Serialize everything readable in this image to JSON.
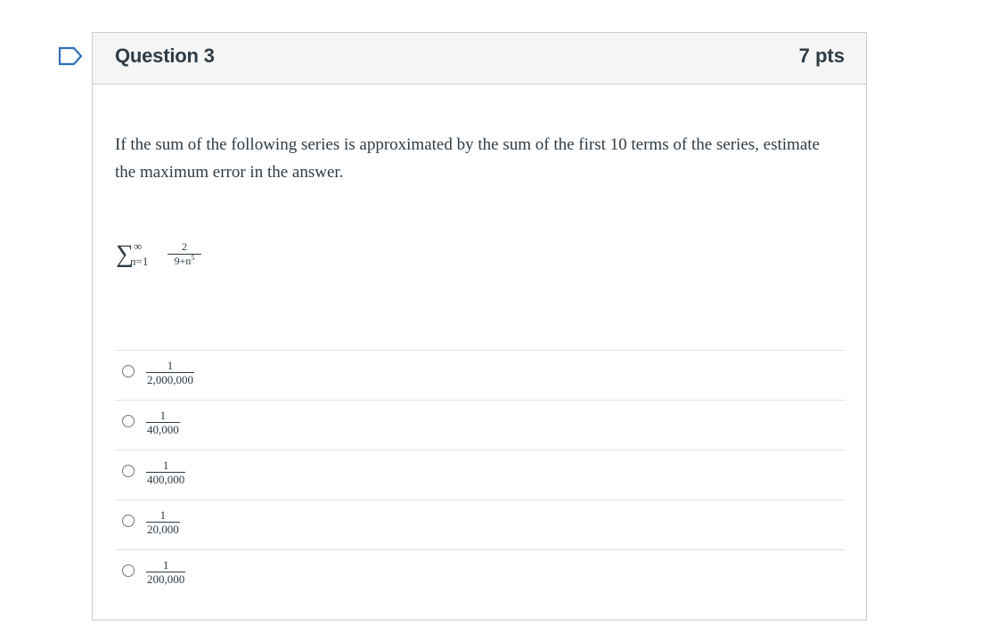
{
  "question": {
    "title": "Question 3",
    "points": "7 pts",
    "text": "If the sum of the following series is approximated by the sum of the first 10 terms of the series, estimate the maximum error in the answer.",
    "formula": {
      "sigma": "∑",
      "upper": "∞",
      "lower_var": "n",
      "lower_eq": "=1",
      "numerator": "2",
      "denominator": "9+n",
      "exponent": "5"
    }
  },
  "answers": [
    {
      "numerator": "1",
      "denominator": "2,000,000"
    },
    {
      "numerator": "1",
      "denominator": "40,000"
    },
    {
      "numerator": "1",
      "denominator": "400,000"
    },
    {
      "numerator": "1",
      "denominator": "20,000"
    },
    {
      "numerator": "1",
      "denominator": "200,000"
    }
  ],
  "colors": {
    "text": "#2d3b45",
    "header_bg": "#f5f5f5",
    "border": "#c7cdd1",
    "flag_outline": "#2d6fb7"
  },
  "icons": {
    "flag": "bookmark-flag-icon",
    "radio": "radio-unchecked-icon"
  }
}
